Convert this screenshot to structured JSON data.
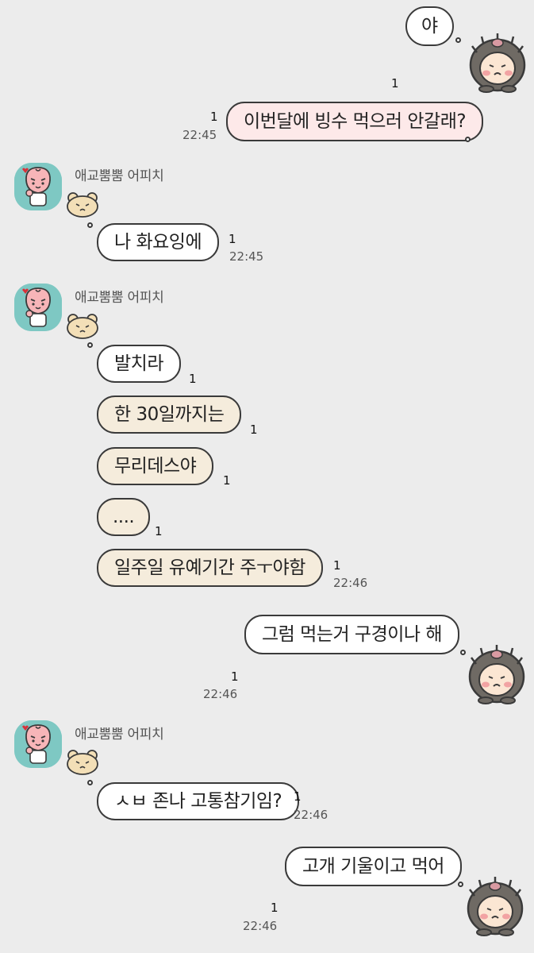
{
  "messages": {
    "m1": {
      "text": "야",
      "read": "1"
    },
    "m2": {
      "text": "이번달에 빙수 먹으러 안갈래?",
      "read": "1",
      "time": "22:45"
    },
    "m3": {
      "sender": "애교뿜뿜 어피치",
      "text": "나 화요잉에",
      "read": "1",
      "time": "22:45"
    },
    "g4": {
      "sender": "애교뿜뿜 어피치",
      "items": [
        {
          "text": "발치라",
          "read": "1"
        },
        {
          "text": "한 30일까지는",
          "read": "1"
        },
        {
          "text": "무리데스야",
          "read": "1"
        },
        {
          "text": "....",
          "read": "1"
        },
        {
          "text": "일주일 유예기간 주ㅜ야함",
          "read": "1"
        }
      ],
      "time": "22:46"
    },
    "m5": {
      "text": "그럼 먹는거 구경이나 해",
      "read": "1",
      "time": "22:46"
    },
    "m6": {
      "sender": "애교뿜뿜 어피치",
      "text": "ㅅㅂ 존나 고통참기임?",
      "read": "1",
      "time": "22:46"
    },
    "m7": {
      "text": "고개 기울이고 먹어",
      "read": "1",
      "time": "22:46"
    }
  },
  "colors": {
    "background": "#ececec",
    "bubble_white": "#ffffff",
    "bubble_pink": "#fde9e9",
    "bubble_beige": "#f5ecdc",
    "avatar_teal": "#7ec8c3"
  },
  "icons": {
    "sender_avatar": "apeach-avatar",
    "sender_emote": "bear-face-emote",
    "my_emote": "hedgehog-character-emote"
  }
}
